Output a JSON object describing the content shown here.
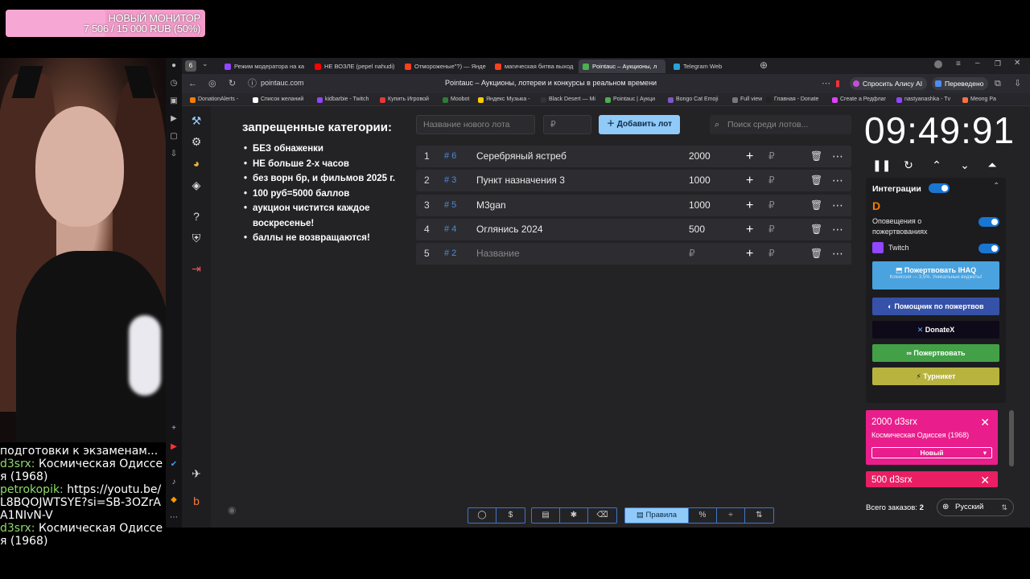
{
  "goal": {
    "title": "НОВЫЙ МОНИТОР",
    "progress_text": "7 506 / 15 000 RUB (50%)",
    "progress_fraction": 0.5,
    "color": "#f59bcb"
  },
  "chat": {
    "lines": [
      {
        "nick": "",
        "text": "подготовки к экзаменам..."
      },
      {
        "nick": "d3srx:",
        "text": "Космическая Одиссея (1968)"
      },
      {
        "nick": "petrokopik:",
        "text": "https://youtu.be/L8BQOJWTSYE?si=SB-3OZrAA1NIvN-V"
      },
      {
        "nick": "d3srx:",
        "text": "Космическая Одиссея (1968)"
      }
    ]
  },
  "browser": {
    "tab_count": "6",
    "tabs": [
      {
        "label": "Режим модератора на ка",
        "color": "#9146ff"
      },
      {
        "label": "НЕ ВОЗЛЕ (pepel nahudi)",
        "color": "#ff0000"
      },
      {
        "label": "Отмороженые\"?) — Янде",
        "color": "#fc3f1d"
      },
      {
        "label": "магическая битва выход",
        "color": "#fc3f1d"
      },
      {
        "label": "Pointauc – Аукционы, л",
        "color": "#4caf50"
      },
      {
        "label": "Telegram Web",
        "color": "#2aa1da"
      }
    ],
    "url": "pointauc.com",
    "page_title": "Pointauc – Аукционы, лотереи и конкурсы в реальном времени",
    "ask_alisa": "Спросить Алису AI",
    "translated": "Переведено",
    "bookmarks": [
      {
        "label": "DonationAlerts -",
        "color": "#f57d07"
      },
      {
        "label": "Список желаний",
        "color": "#ffffff"
      },
      {
        "label": "kidbarbie - Twitch",
        "color": "#9146ff"
      },
      {
        "label": "Купить Игровой",
        "color": "#e53935"
      },
      {
        "label": "Moobot",
        "color": "#2e7d32"
      },
      {
        "label": "Яндекс Музыка -",
        "color": "#ffcc00"
      },
      {
        "label": "Black Desert — Mi",
        "color": "#333333"
      },
      {
        "label": "Pointauc | Аукци",
        "color": "#4caf50"
      },
      {
        "label": "Bongo Cat Emoji",
        "color": "#7e57c2"
      },
      {
        "label": "Full view",
        "color": "#777777"
      },
      {
        "label": "Главная - Donate",
        "color": "#222222"
      },
      {
        "label": "Create a Редфлаг",
        "color": "#e040fb"
      },
      {
        "label": "nastyanashka - Tv",
        "color": "#9146ff"
      },
      {
        "label": "Meong Pa",
        "color": "#ff7043"
      }
    ]
  },
  "auction": {
    "rules_title": "запрещенные категории:",
    "rules": [
      "БЕЗ обнаженки",
      "НЕ больше 2-х часов",
      "без ворн бр, и фильмов 2025 г.",
      "100 руб=5000 баллов",
      "аукцион чистится каждое воскресенье!",
      "баллы не возвращаются!"
    ],
    "new_lot_placeholder": "Название нового лота",
    "amount_placeholder": "₽",
    "add_lot_label": "Добавить лот",
    "search_placeholder": "Поиск среди лотов...",
    "currency": "₽",
    "lots": [
      {
        "n": "1",
        "id": "# 6",
        "name": "Серебряный ястреб",
        "amount": "2000",
        "placeholder": false
      },
      {
        "n": "2",
        "id": "# 3",
        "name": "Пункт назначения 3",
        "amount": "1000",
        "placeholder": false
      },
      {
        "n": "3",
        "id": "# 5",
        "name": "M3gan",
        "amount": "1000",
        "placeholder": false
      },
      {
        "n": "4",
        "id": "# 4",
        "name": "Оглянись 2024",
        "amount": "500",
        "placeholder": false
      },
      {
        "n": "5",
        "id": "# 2",
        "name": "Название",
        "amount": "₽",
        "placeholder": true
      }
    ],
    "timer": "09:49:91"
  },
  "integrations": {
    "title": "Интеграции",
    "donation_alerts_label": "Оповещения о пожертвованиях",
    "twitch_label": "Twitch",
    "ihaq": {
      "label": "Пожертвовать IHAQ",
      "sub": "Комиссия — 3,5%. Уникальные виджеты!",
      "color": "#4aa3df"
    },
    "buttons": [
      {
        "label": "Помощник по пожертвов",
        "color": "#3552a8"
      },
      {
        "label": "DonateX",
        "color": "#0e0a1a"
      },
      {
        "label": "Пожертвовать",
        "color": "#43a047"
      },
      {
        "label": "Турникет",
        "color": "#b8b33f"
      }
    ]
  },
  "alerts": [
    {
      "title": "2000 d3srx",
      "sub": "Космическая Одиссея (1968)",
      "status": "Новый",
      "color": "#e91e8c"
    },
    {
      "title": "500 d3srx",
      "color": "#e91e63"
    }
  ],
  "orders": {
    "label": "Всего заказов:",
    "count": "2"
  },
  "language": "Русский",
  "bottom_toolbar": {
    "rules_label": "Правила"
  }
}
